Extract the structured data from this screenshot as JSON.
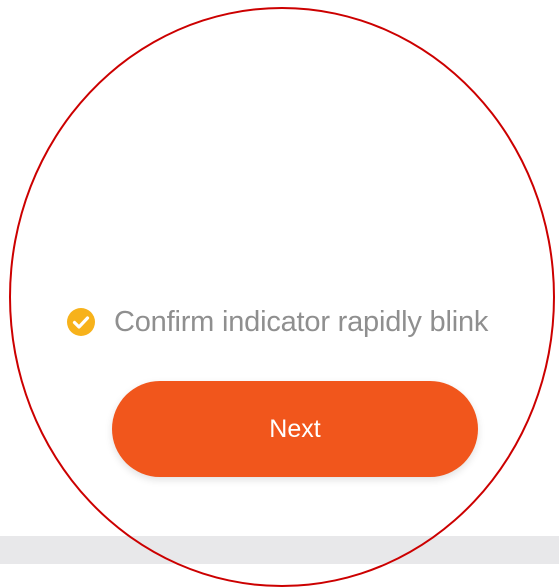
{
  "confirm": {
    "label": "Confirm indicator rapidly blink",
    "checked": true,
    "icon": "check-circle-icon",
    "check_color": "#f7b21b"
  },
  "next_button": {
    "label": "Next",
    "color": "#f1561c"
  },
  "highlight_color": "#cc0000"
}
